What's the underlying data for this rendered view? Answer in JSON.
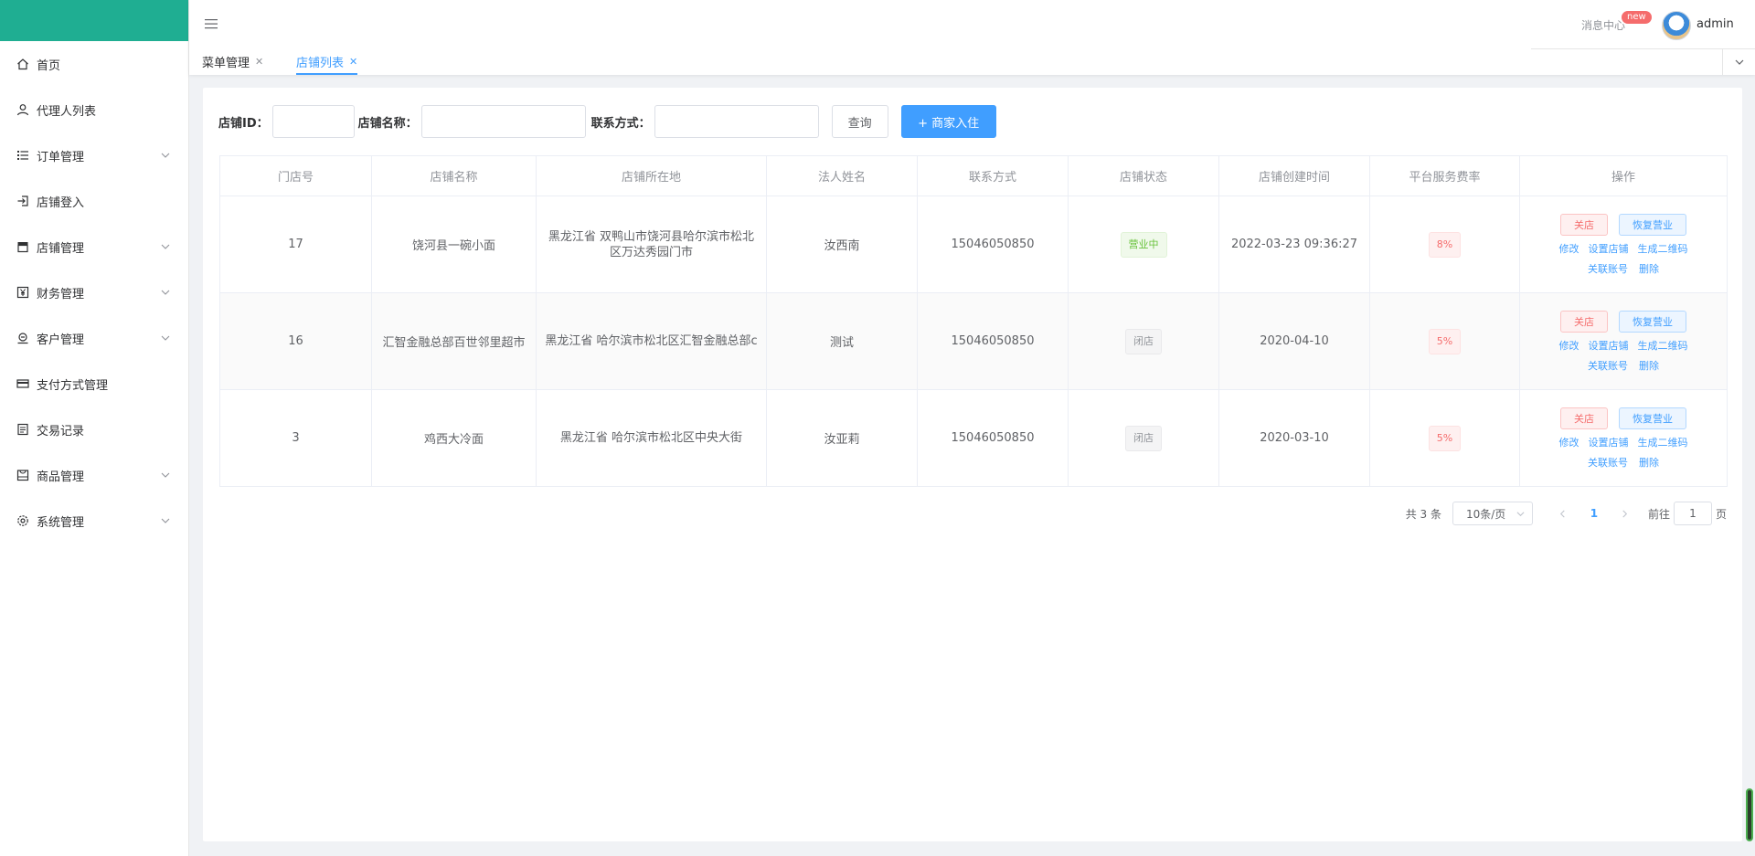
{
  "sidebar": {
    "items": [
      {
        "label": "首页",
        "icon": "home-icon",
        "has_children": false
      },
      {
        "label": "代理人列表",
        "icon": "user-icon",
        "has_children": false
      },
      {
        "label": "订单管理",
        "icon": "list-icon",
        "has_children": true
      },
      {
        "label": "店铺登入",
        "icon": "login-icon",
        "has_children": false
      },
      {
        "label": "店铺管理",
        "icon": "shop-icon",
        "has_children": true
      },
      {
        "label": "财务管理",
        "icon": "yen-icon",
        "has_children": true
      },
      {
        "label": "客户管理",
        "icon": "customer-icon",
        "has_children": true
      },
      {
        "label": "支付方式管理",
        "icon": "card-icon",
        "has_children": false
      },
      {
        "label": "交易记录",
        "icon": "record-icon",
        "has_children": false
      },
      {
        "label": "商品管理",
        "icon": "goods-icon",
        "has_children": true
      },
      {
        "label": "系统管理",
        "icon": "gear-icon",
        "has_children": true
      }
    ]
  },
  "header": {
    "message_center": "消息中心",
    "badge": "new",
    "username": "admin"
  },
  "tabs": [
    {
      "label": "菜单管理",
      "active": false
    },
    {
      "label": "店铺列表",
      "active": true
    }
  ],
  "search": {
    "shop_id_label": "店铺ID：",
    "shop_name_label": "店铺名称：",
    "contact_label": "联系方式：",
    "query_button": "查询",
    "add_button": "+ 商家入住"
  },
  "table": {
    "columns": [
      "门店号",
      "店铺名称",
      "店铺所在地",
      "法人姓名",
      "联系方式",
      "店铺状态",
      "店铺创建时间",
      "平台服务费率",
      "操作"
    ],
    "rows": [
      {
        "id": "17",
        "name": "饶河县一碗小面",
        "location": "黑龙江省 双鸭山市饶河县哈尔滨市松北区万达秀园门市",
        "legal": "汝西南",
        "contact": "15046050850",
        "status": "营业中",
        "status_type": "success",
        "created": "2022-03-23 09:36:27",
        "fee": "8%"
      },
      {
        "id": "16",
        "name": "汇智金融总部百世邻里超市",
        "location": "黑龙江省 哈尔滨市松北区汇智金融总部c",
        "legal": "测试",
        "contact": "15046050850",
        "status": "闭店",
        "status_type": "info",
        "created": "2020-04-10",
        "fee": "5%"
      },
      {
        "id": "3",
        "name": "鸡西大冷面",
        "location": "黑龙江省 哈尔滨市松北区中央大街",
        "legal": "汝亚莉",
        "contact": "15046050850",
        "status": "闭店",
        "status_type": "info",
        "created": "2020-03-10",
        "fee": "5%"
      }
    ],
    "ops": {
      "close": "关店",
      "resume": "恢复营业",
      "edit": "修改",
      "settings": "设置店铺",
      "qrcode": "生成二维码",
      "link_account": "关联账号",
      "delete": "删除"
    }
  },
  "pagination": {
    "total": "共 3 条",
    "page_size": "10条/页",
    "current": "1",
    "goto_label": "前往",
    "goto_value": "1",
    "page_suffix": "页"
  },
  "colors": {
    "logo_bar": "#1fae92",
    "primary": "#409eff",
    "danger": "#f56c6c",
    "success": "#67c23a"
  }
}
